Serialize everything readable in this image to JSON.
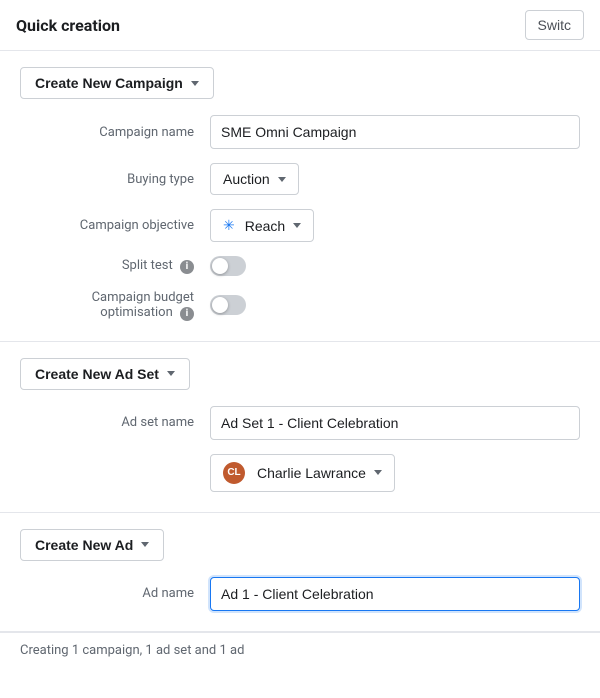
{
  "header": {
    "title": "Quick creation",
    "switch_btn_label": "Switc"
  },
  "campaign_section": {
    "header_btn_label": "Create New Campaign",
    "fields": {
      "campaign_name_label": "Campaign name",
      "campaign_name_value": "SME Omni Campaign",
      "buying_type_label": "Buying type",
      "buying_type_value": "Auction",
      "campaign_objective_label": "Campaign objective",
      "campaign_objective_value": "Reach",
      "split_test_label": "Split test",
      "campaign_budget_label": "Campaign budget optimisation"
    }
  },
  "ad_set_section": {
    "header_btn_label": "Create New Ad Set",
    "fields": {
      "ad_set_name_label": "Ad set name",
      "ad_set_name_value": "Ad Set 1 - Client Celebration",
      "owner_value": "Charlie Lawrance"
    }
  },
  "ad_section": {
    "header_btn_label": "Create New Ad",
    "fields": {
      "ad_name_label": "Ad name",
      "ad_name_value": "Ad 1 - Client Celebration"
    }
  },
  "footer": {
    "status_text": "Creating 1 campaign, 1 ad set and 1 ad"
  },
  "icons": {
    "chevron_down": "▾",
    "info": "i",
    "reach_symbol": "✳"
  }
}
